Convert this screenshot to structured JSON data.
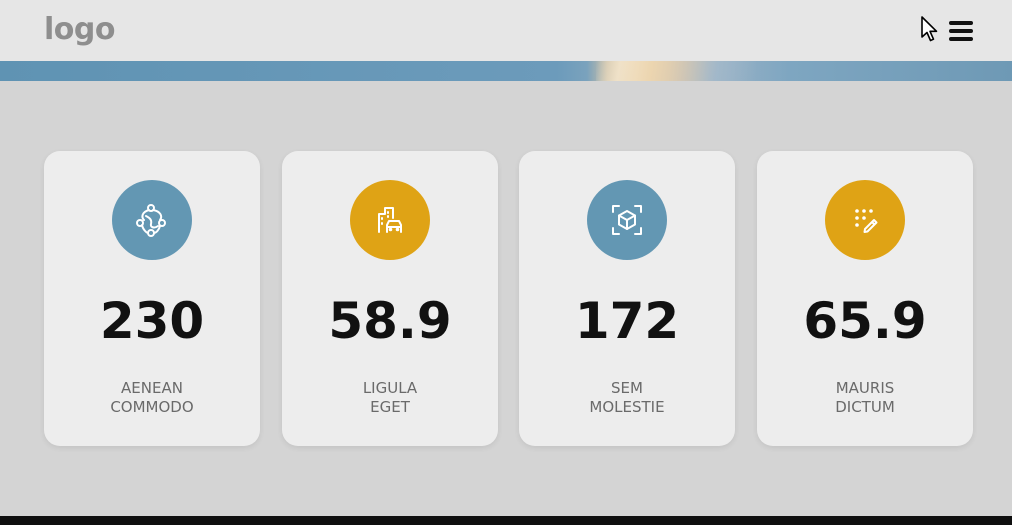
{
  "header": {
    "logo_text": "logo",
    "menu_icon": "hamburger-menu-icon"
  },
  "colors": {
    "blue": "#6397b3",
    "gold": "#dfa315",
    "header_bg": "#e6e6e6",
    "page_bg": "#d4d4d4",
    "card_bg": "#ededed"
  },
  "stats": [
    {
      "icon": "network-icon",
      "value": "230",
      "label_line1": "AENEAN",
      "label_line2": "COMMODO",
      "color": "#6397b3"
    },
    {
      "icon": "city-car-icon",
      "value": "58.9",
      "label_line1": "LIGULA",
      "label_line2": "EGET",
      "color": "#dfa315"
    },
    {
      "icon": "cube-scan-icon",
      "value": "172",
      "label_line1": "SEM",
      "label_line2": "MOLESTIE",
      "color": "#6397b3"
    },
    {
      "icon": "magic-wand-icon",
      "value": "65.9",
      "label_line1": "MAURIS",
      "label_line2": "DICTUM",
      "color": "#dfa315"
    }
  ]
}
